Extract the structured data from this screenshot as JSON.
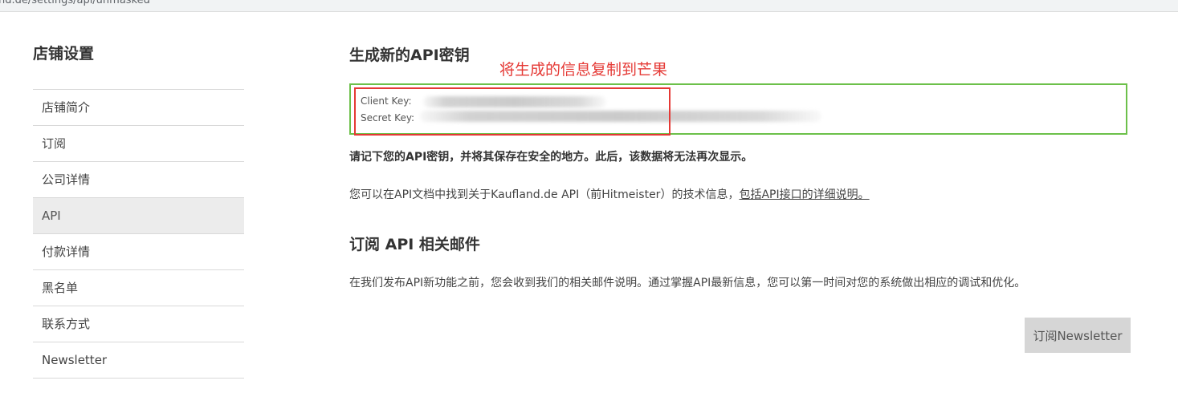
{
  "browser": {
    "url_fragment": "nd.de/settings/api/unmasked"
  },
  "sidebar": {
    "title": "店铺设置",
    "items": [
      {
        "label": "店铺简介",
        "active": false
      },
      {
        "label": "订阅",
        "active": false
      },
      {
        "label": "公司详情",
        "active": false
      },
      {
        "label": "API",
        "active": true
      },
      {
        "label": "付款详情",
        "active": false
      },
      {
        "label": "黑名单",
        "active": false
      },
      {
        "label": "联系方式",
        "active": false
      },
      {
        "label": "Newsletter",
        "active": false
      }
    ]
  },
  "api_section": {
    "title": "生成新的API密钥",
    "client_key_label": "Client Key:",
    "secret_key_label": "Secret Key:",
    "warning": "请记下您的API密钥，并将其保存在安全的地方。此后，该数据将无法再次显示。",
    "docs_text": "您可以在API文档中找到关于Kaufland.de API（前Hitmeister）的技术信息，",
    "docs_link": "包括API接口的详细说明。"
  },
  "annotation": {
    "text": "将生成的信息复制到芒果",
    "color": "#e53935"
  },
  "subscribe_section": {
    "title": "订阅 API 相关邮件",
    "description": "在我们发布API新功能之前，您会收到我们的相关邮件说明。通过掌握API最新信息，您可以第一时间对您的系统做出相应的调试和优化。",
    "button_label": "订阅Newsletter"
  },
  "colors": {
    "key_box_border": "#6cc04a",
    "annotation": "#e53935",
    "active_item_bg": "#ececec",
    "button_bg": "#d6d6d6"
  }
}
